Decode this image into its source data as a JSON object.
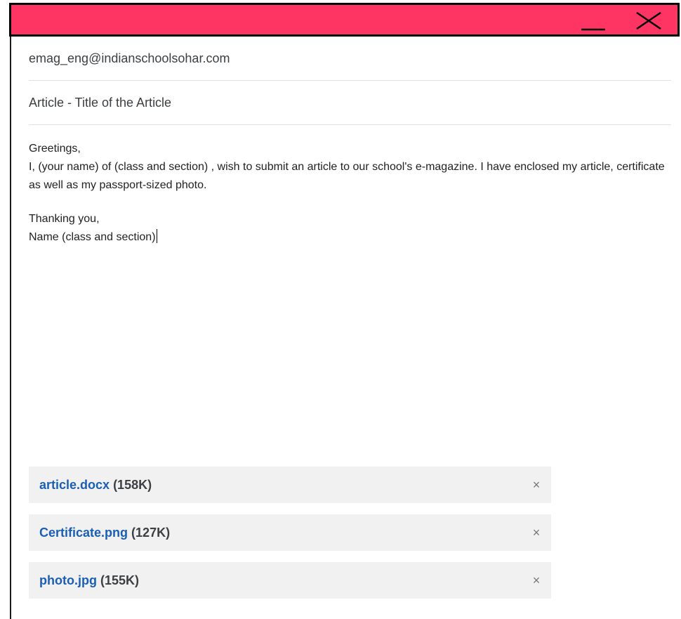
{
  "window": {
    "accent_color": "#fe3462",
    "minimize_icon": "minimize-icon",
    "close_icon": "close-icon"
  },
  "compose": {
    "to": "emag_eng@indianschoolsohar.com",
    "subject": "Article - Title of the Article",
    "body": {
      "greeting": "Greetings,",
      "line1": "I, (your name) of (class and section) , wish to submit an article to our school's e-magazine. I have enclosed my article, certificate as well as my passport-sized photo.",
      "closing": "Thanking you,",
      "signature": "Name (class and section)"
    },
    "attachments": [
      {
        "name": "article.docx",
        "size": "(158K)",
        "remove": "×"
      },
      {
        "name": "Certificate.png",
        "size": "(127K)",
        "remove": "×"
      },
      {
        "name": "photo.jpg",
        "size": "(155K)",
        "remove": "×"
      }
    ]
  }
}
